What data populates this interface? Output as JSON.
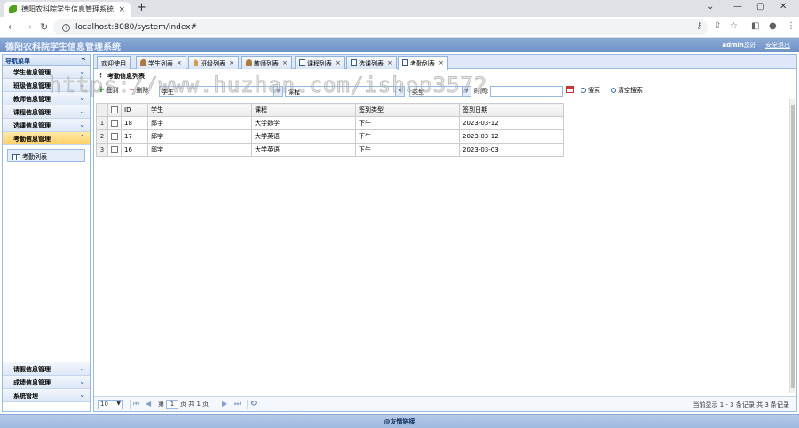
{
  "browser": {
    "tab_title": "德阳农科院学生信息管理系统 管理后台",
    "tab_close": "×",
    "new_tab": "+",
    "url": "localhost:8080/system/index#"
  },
  "header": {
    "title": "德阳农科院学生信息管理系统",
    "username": "admin",
    "greeting": "您好",
    "logout": "安全退出"
  },
  "sidebar": {
    "title": "导航菜单",
    "top_items": [
      {
        "label": "学生信息管理"
      },
      {
        "label": "班级信息管理"
      },
      {
        "label": "教师信息管理"
      },
      {
        "label": "课程信息管理"
      },
      {
        "label": "选课信息管理"
      },
      {
        "label": "考勤信息管理"
      }
    ],
    "active_link": "考勤列表",
    "bottom_items": [
      {
        "label": "请假信息管理"
      },
      {
        "label": "成绩信息管理"
      },
      {
        "label": "系统管理"
      }
    ]
  },
  "tabs": [
    {
      "label": "欢迎使用"
    },
    {
      "label": "学生列表"
    },
    {
      "label": "班级列表"
    },
    {
      "label": "教师列表"
    },
    {
      "label": "课程列表"
    },
    {
      "label": "选课列表"
    },
    {
      "label": "考勤列表"
    }
  ],
  "list_title": "考勤信息列表",
  "toolbar": {
    "add": "签到",
    "delete": "删除",
    "student_placeholder": "学生",
    "course_placeholder": "课程",
    "type_placeholder": "类型",
    "time_label": "时间:",
    "search": "搜索",
    "clear": "清空搜索"
  },
  "table": {
    "columns": [
      "ID",
      "学生",
      "课程",
      "签到类型",
      "签到日期"
    ],
    "rows": [
      {
        "num": "1",
        "id": "18",
        "student": "邱宇",
        "course": "大学数学",
        "type": "下午",
        "date": "2023-03-12"
      },
      {
        "num": "2",
        "id": "17",
        "student": "邱宇",
        "course": "大学英语",
        "type": "下午",
        "date": "2023-03-12"
      },
      {
        "num": "3",
        "id": "16",
        "student": "邱宇",
        "course": "大学英语",
        "type": "下午",
        "date": "2023-03-03"
      }
    ]
  },
  "pager": {
    "page_size": "10",
    "page_prefix": "第",
    "current_page": "1",
    "page_suffix": "页 共 1 页",
    "info": "当前显示 1 - 3 条记录 共 3 条记录"
  },
  "footer": "@友情链接",
  "watermark": "https://www.huzhan.com/ishop3572"
}
